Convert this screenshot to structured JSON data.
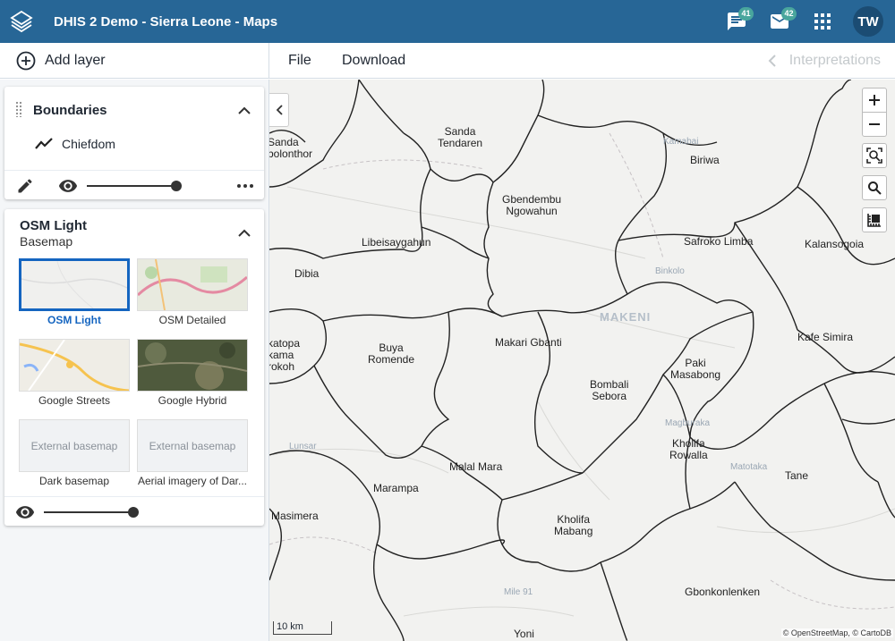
{
  "header": {
    "title": "DHIS 2 Demo - Sierra Leone - Maps",
    "messages_badge": "41",
    "email_badge": "42",
    "user_initials": "TW"
  },
  "toolbar": {
    "add_layer": "Add layer",
    "file": "File",
    "download": "Download",
    "interpretations": "Interpretations"
  },
  "layers": {
    "boundaries": {
      "title": "Boundaries",
      "legend_item": "Chiefdom",
      "opacity": 1.0
    },
    "basemap": {
      "title": "OSM Light",
      "subtitle": "Basemap",
      "opacity": 1.0,
      "options": [
        {
          "label": "OSM Light",
          "selected": true,
          "thumb": ""
        },
        {
          "label": "OSM Detailed",
          "selected": false,
          "thumb": ""
        },
        {
          "label": "Google Streets",
          "selected": false,
          "thumb": ""
        },
        {
          "label": "Google Hybrid",
          "selected": false,
          "thumb": ""
        },
        {
          "label": "Dark basemap",
          "selected": false,
          "thumb": "External basemap"
        },
        {
          "label": "Aerial imagery of Dar...",
          "selected": false,
          "thumb": "External basemap"
        }
      ]
    }
  },
  "map": {
    "labels": [
      "Sanda Tendaren",
      "Sanda bolonthor",
      "Biriwa",
      "Gbendembu Ngowahun",
      "Libeisaygahun",
      "Safroko Limba",
      "Kalansogoia",
      "Dibia",
      "Makari Gbanti",
      "Buya Romende",
      "katopa kama rokoh",
      "Kafe Simira",
      "Paki Masabong",
      "Bombali Sebora",
      "Kholifa Rowalla",
      "Malal Mara",
      "Tane",
      "Marampa",
      "Masimera",
      "Kholifa Mabang",
      "Gbonkonlenken",
      "Yoni"
    ],
    "place_labels": [
      "Kamabai",
      "Binkolo",
      "MAKENI",
      "Magburaka",
      "Lunsar",
      "Matotaka",
      "Mile 91"
    ],
    "scale": "10 km",
    "attribution": "© OpenStreetMap, © CartoDB"
  },
  "colors": {
    "header": "#276696",
    "selected": "#1565c0",
    "badge": "#49a69d"
  }
}
